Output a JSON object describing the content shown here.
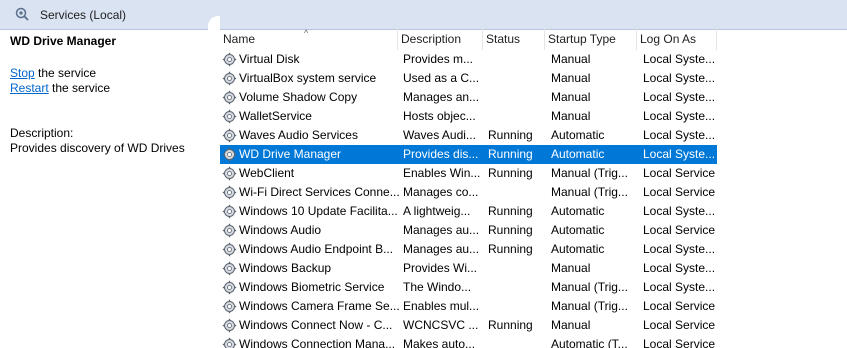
{
  "window": {
    "title": "Services (Local)",
    "icon": "gear-search-icon"
  },
  "left_pane": {
    "service_title": "WD Drive Manager",
    "stop_link": "Stop",
    "stop_suffix": " the service",
    "restart_link": "Restart",
    "restart_suffix": " the service",
    "description_label": "Description:",
    "description_text": "Provides discovery of WD Drives"
  },
  "columns": [
    "Name",
    "Description",
    "Status",
    "Startup Type",
    "Log On As"
  ],
  "rows": [
    {
      "name": "Virtual Disk",
      "description": "Provides m...",
      "status": "",
      "startup": "Manual",
      "logon": "Local Syste..."
    },
    {
      "name": "VirtualBox system service",
      "description": "Used as a C...",
      "status": "",
      "startup": "Manual",
      "logon": "Local Syste..."
    },
    {
      "name": "Volume Shadow Copy",
      "description": "Manages an...",
      "status": "",
      "startup": "Manual",
      "logon": "Local Syste..."
    },
    {
      "name": "WalletService",
      "description": "Hosts objec...",
      "status": "",
      "startup": "Manual",
      "logon": "Local Syste..."
    },
    {
      "name": "Waves Audio Services",
      "description": "Waves Audi...",
      "status": "Running",
      "startup": "Automatic",
      "logon": "Local Syste..."
    },
    {
      "name": "WD Drive Manager",
      "description": "Provides dis...",
      "status": "Running",
      "startup": "Automatic",
      "logon": "Local Syste...",
      "selected": true
    },
    {
      "name": "WebClient",
      "description": "Enables Win...",
      "status": "Running",
      "startup": "Manual (Trig...",
      "logon": "Local Service"
    },
    {
      "name": "Wi-Fi Direct Services Conne...",
      "description": "Manages co...",
      "status": "",
      "startup": "Manual (Trig...",
      "logon": "Local Service"
    },
    {
      "name": "Windows 10 Update Facilita...",
      "description": "A lightweig...",
      "status": "Running",
      "startup": "Automatic",
      "logon": "Local Syste..."
    },
    {
      "name": "Windows Audio",
      "description": "Manages au...",
      "status": "Running",
      "startup": "Automatic",
      "logon": "Local Service"
    },
    {
      "name": "Windows Audio Endpoint B...",
      "description": "Manages au...",
      "status": "Running",
      "startup": "Automatic",
      "logon": "Local Syste..."
    },
    {
      "name": "Windows Backup",
      "description": "Provides Wi...",
      "status": "",
      "startup": "Manual",
      "logon": "Local Syste..."
    },
    {
      "name": "Windows Biometric Service",
      "description": "The Windo...",
      "status": "",
      "startup": "Manual (Trig...",
      "logon": "Local Syste..."
    },
    {
      "name": "Windows Camera Frame Se...",
      "description": "Enables mul...",
      "status": "",
      "startup": "Manual (Trig...",
      "logon": "Local Service"
    },
    {
      "name": "Windows Connect Now - C...",
      "description": "WCNCSVC ...",
      "status": "Running",
      "startup": "Manual",
      "logon": "Local Service"
    },
    {
      "name": "Windows Connection Mana...",
      "description": "Makes auto...",
      "status": "",
      "startup": "Automatic (T...",
      "logon": "Local Service"
    }
  ],
  "colors": {
    "selection": "#0078d7",
    "link": "#0066cc",
    "titlebar": "#d9e3f1"
  }
}
